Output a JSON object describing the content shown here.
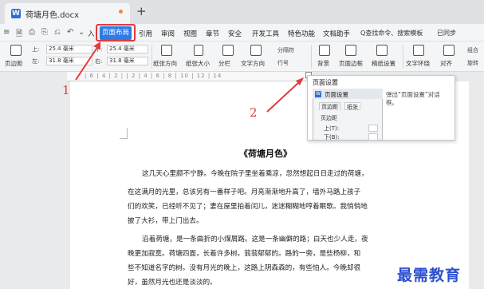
{
  "window": {
    "tab_title": "荷塘月色.docx",
    "tab_icon_glyph": "W",
    "new_tab_glyph": "+"
  },
  "menubar": {
    "quick_access": [
      "≡",
      "🗎",
      "⎙",
      "⎘",
      "⎌",
      "↶",
      "⌄"
    ],
    "items": [
      "入",
      "页面布局",
      "引用",
      "审阅",
      "视图",
      "章节",
      "安全",
      "开发工具",
      "特色功能",
      "文档助手"
    ],
    "search_label": "Q查找命令、搜索模板",
    "cloud_label": "已同步",
    "accent_color": "#2f7be6"
  },
  "ribbon": {
    "margins_label": "页边距",
    "top_field": "25.4 毫米",
    "bottom_field": "25.4 毫米",
    "left_field": "31.8 毫米",
    "right_field": "31.8 毫米",
    "top_prefix": "上:",
    "bottom_prefix": "下:",
    "left_prefix": "左:",
    "right_prefix": "右:",
    "orientation": "纸张方向",
    "size": "纸张大小",
    "columns": "分栏",
    "text_direction": "文字方向",
    "line_numbers": "行号",
    "breaks": "分隔符",
    "background": "背景",
    "page_border": "页面边框",
    "draft_paper": "稿纸设置",
    "wrap_text": "文字环绕",
    "align": "对齐",
    "rotate": "旋转",
    "group": "组合"
  },
  "ruler": {
    "marks": "| 6 | 4 | 2 |     | 2 | 4 | 6 | 8 | 10 | 12 | 14"
  },
  "tooltip": {
    "title": "页面设置",
    "description": "弹出“页面设置”对话框。",
    "dialog_title": "页面设置",
    "dialog_icon_glyph": "W",
    "tab_margins": "页边距",
    "tab_paper": "纸张",
    "section_label": "页边距",
    "field_top": "上(T):",
    "field_bottom": "下(B):"
  },
  "document": {
    "title": "《荷塘月色》",
    "lines": [
      "这几天心里颇不宁静。今晚在院子里坐着乘凉，忽然想起日日走过的荷塘，",
      "在这满月的光里，总该另有一番样子吧。月亮渐渐地升高了，墙外马路上孩子",
      "们的欢笑，已经听不见了；妻在屋里拍着闰儿，迷迷糊糊地哼着眠歌。我悄悄地",
      "披了大衫，带上门出去。",
      "沿着荷塘，是一条曲折的小煤屑路。这是一条幽僻的路；白天也少人走，夜",
      "晚更加寂寞。荷塘四面，长着许多树，蓊蓊郁郁的。路的一旁，是些杨柳，和",
      "些不知道名字的树。没有月光的晚上，这路上阴森森的，有些怕人。今晚却很",
      "好，虽然月光也还是淡淡的。"
    ]
  },
  "annotations": {
    "step1": "1",
    "step2": "2",
    "color": "#e03c3c"
  },
  "watermark": "最需教育"
}
